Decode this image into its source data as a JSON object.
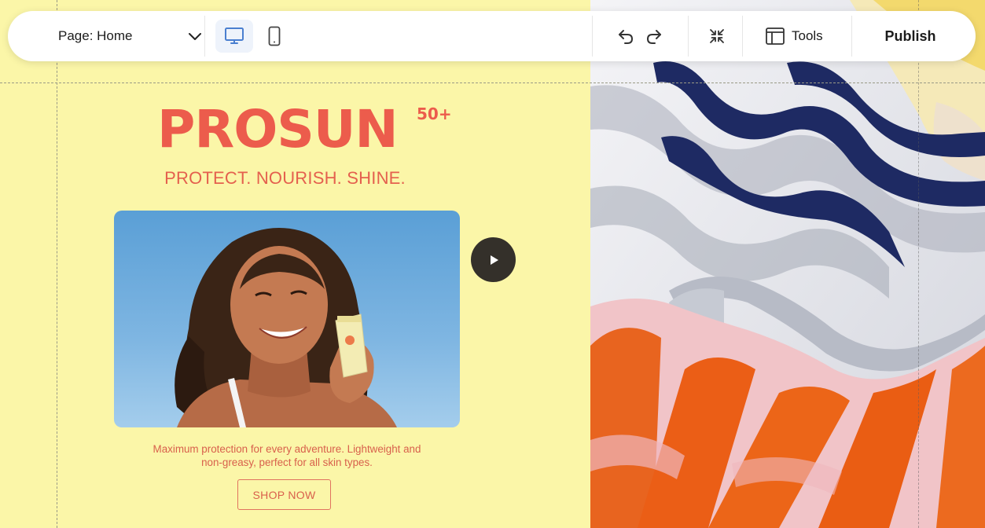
{
  "toolbar": {
    "page_select_label": "Page: Home",
    "tools_label": "Tools",
    "publish_label": "Publish",
    "icons": {
      "dropdown": "chevron-down-icon",
      "desktop": "desktop-icon",
      "mobile": "mobile-icon",
      "undo": "undo-icon",
      "redo": "redo-icon",
      "collapse": "collapse-icon",
      "tools": "panel-layout-icon"
    }
  },
  "hero": {
    "brand": "PROSUN",
    "brand_sup": "50+",
    "tagline": "PROTECT. NOURISH. SHINE.",
    "description": "Maximum protection for every adventure. Lightweight and non-greasy, perfect for all skin types.",
    "cta_label": "SHOP NOW"
  },
  "colors": {
    "canvas_background": "#fbf6a8",
    "brand": "#ec5c4c",
    "toolbar_background": "#ffffff",
    "active_device": "#eef3fb",
    "play_button": "#34302a"
  }
}
